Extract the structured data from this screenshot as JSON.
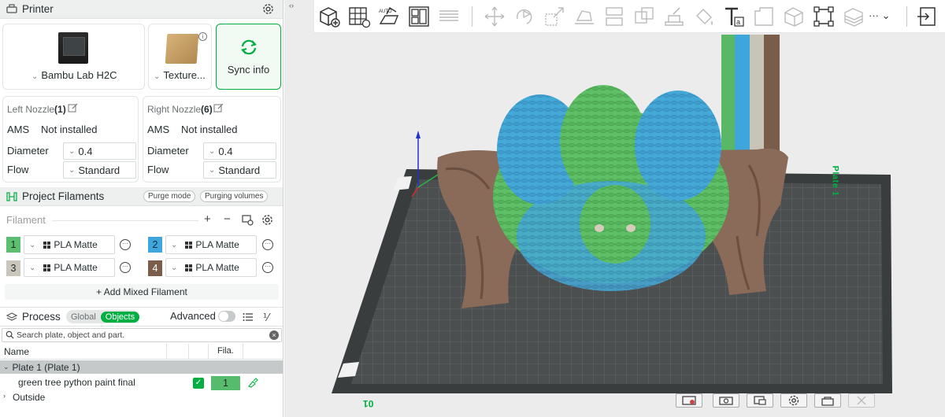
{
  "printer": {
    "title": "Printer",
    "model": "Bambu Lab H2C",
    "plate": "Texture...",
    "sync_label": "Sync info"
  },
  "nozzles": {
    "left": {
      "title": "Left Nozzle",
      "index": "(1)",
      "ams_label": "AMS",
      "ams_value": "Not installed",
      "diameter_label": "Diameter",
      "diameter_value": "0.4",
      "flow_label": "Flow",
      "flow_value": "Standard"
    },
    "right": {
      "title": "Right Nozzle",
      "index": "(6)",
      "ams_label": "AMS",
      "ams_value": "Not installed",
      "diameter_label": "Diameter",
      "diameter_value": "0.4",
      "flow_label": "Flow",
      "flow_value": "Standard"
    }
  },
  "filaments": {
    "title": "Project Filaments",
    "purge_mode": "Purge mode",
    "purging_volumes": "Purging volumes",
    "header": "Filament",
    "items": [
      {
        "num": "1",
        "name": "PLA Matte",
        "color": "#5cbf6f",
        "text": "#1b2a1e"
      },
      {
        "num": "2",
        "name": "PLA Matte",
        "color": "#3fa6dc",
        "text": "#0d2a3a"
      },
      {
        "num": "3",
        "name": "PLA Matte",
        "color": "#cbc6bb",
        "text": "#2b2b2b"
      },
      {
        "num": "4",
        "name": "PLA Matte",
        "color": "#7b5d4c",
        "text": "#ffffff"
      }
    ],
    "add_mixed": "+ Add Mixed Filament"
  },
  "process": {
    "title": "Process",
    "global": "Global",
    "objects": "Objects",
    "advanced": "Advanced"
  },
  "objects": {
    "search_placeholder": "Search plate, object and part.",
    "col_name": "Name",
    "col_fila": "Fila.",
    "plate_row": "Plate 1 (Plate 1)",
    "object_name": "green tree python paint final",
    "object_fila": "1",
    "outside": "Outside"
  },
  "viewport": {
    "plate_label": "Plate 1",
    "plate_number": "01",
    "accent": "#00ae42"
  },
  "icons": {
    "toolbar": [
      "add-cube-icon",
      "grid-icon",
      "auto-orient-icon",
      "arrange-icon",
      "layers-icon",
      "move-icon",
      "rotate-icon",
      "scale-icon",
      "lay-on-face-icon",
      "cut-icon",
      "boolean-icon",
      "support-paint-icon",
      "seam-paint-icon",
      "color-paint-icon",
      "text-icon",
      "emboss-icon",
      "assembly-icon",
      "measure-icon",
      "layer-height-icon",
      "more-icon",
      "export-icon"
    ]
  }
}
